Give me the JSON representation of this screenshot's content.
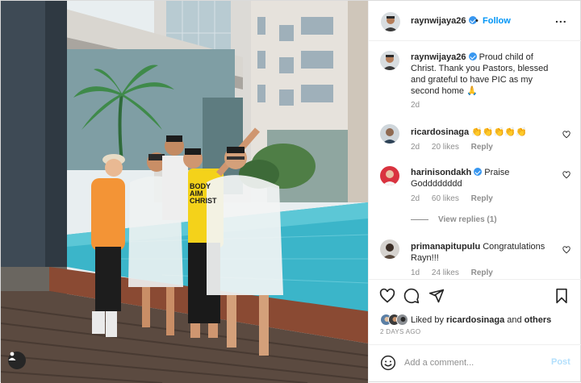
{
  "post": {
    "author": "raynwijaya26",
    "follow_label": "Follow",
    "dot": "•",
    "more_label": "...",
    "caption": "Proud child of Christ. Thank you Pastors, blessed and grateful to have PIC as my second home 🙏",
    "caption_age": "2d",
    "photo_shirt_text": "BODY AIM CHRIST"
  },
  "comments": [
    {
      "user": "ricardosinaga",
      "text": "👏👏👏👏👏",
      "age": "2d",
      "likes": "20 likes",
      "reply": "Reply"
    },
    {
      "user": "harinisondakh",
      "text": "Praise Godddddddd",
      "age": "2d",
      "likes": "60 likes",
      "reply": "Reply",
      "view_replies": "View replies (1)"
    },
    {
      "user": "primanapitupulu",
      "text": "Congratulations Rayn!!!",
      "age": "1d",
      "likes": "24 likes",
      "reply": "Reply"
    }
  ],
  "likes": {
    "prefix": "Liked by",
    "user": "ricardosinaga",
    "and": "and",
    "others": "others"
  },
  "timestamp": "2 DAYS AGO",
  "add_comment": {
    "placeholder": "Add a comment...",
    "post_label": "Post"
  },
  "colors": {
    "accent": "#0095f6",
    "verified": "#3897f0",
    "post_disabled": "#b2dffc",
    "muted": "#8e8e8e"
  },
  "icons": [
    "heart-icon",
    "comment-icon",
    "share-icon",
    "bookmark-icon",
    "emoji-icon",
    "more-icon",
    "user-tag-icon",
    "verified-icon"
  ]
}
